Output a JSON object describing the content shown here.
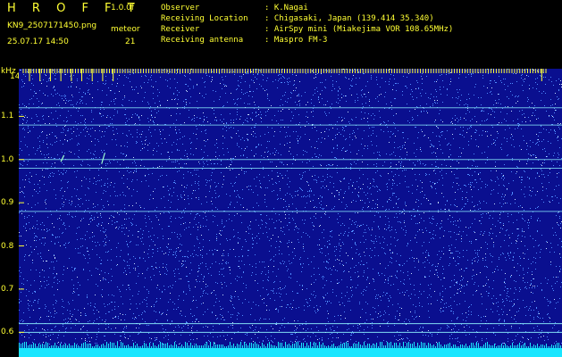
{
  "header": {
    "brand": "H R O F F T",
    "version": "1.0.0f",
    "filename": "KN9_2507171450.png",
    "meteor_label": "meteor",
    "timestamp": "25.07.17 14:50",
    "meteor_count": "21",
    "fields": [
      {
        "label": "Observer",
        "value": ": K.Nagai"
      },
      {
        "label": "Receiving Location",
        "value": ": Chigasaki, Japan (139.414 35.340)"
      },
      {
        "label": "Receiver",
        "value": ": AirSpy mini (Miakejima VOR 108.65MHz)"
      },
      {
        "label": "Receiving antenna",
        "value": ": Maspro FM-3"
      }
    ]
  },
  "chart_data": {
    "type": "heatmap",
    "ylabel": "kHz",
    "ylim": [
      0.58,
      1.2
    ],
    "yticks": [
      "1.1",
      "1.0",
      "0.9",
      "0.8",
      "0.7",
      "0.6"
    ],
    "xlim": [
      1450.4,
      1500.4
    ],
    "xticks": [
      "1451",
      "1452",
      "1453",
      "1454",
      "1455",
      "1456",
      "1457",
      "1458",
      "1459",
      "1500"
    ],
    "carrier_lines_khz": [
      1.12,
      1.08,
      1.0,
      0.98,
      0.88,
      0.62,
      0.6
    ],
    "meteor_echoes": [
      {
        "x0": 1454.0,
        "y0": 0.995,
        "x1": 1454.3,
        "y1": 1.01
      },
      {
        "x0": 1457.9,
        "y0": 0.99,
        "x1": 1458.2,
        "y1": 1.015
      }
    ],
    "colors": {
      "background": "#0a0f8f",
      "noise": "#4f8cff",
      "line": "#8ff5ff",
      "text": "#ffff33",
      "bottom_band": "#19e6ff"
    }
  }
}
